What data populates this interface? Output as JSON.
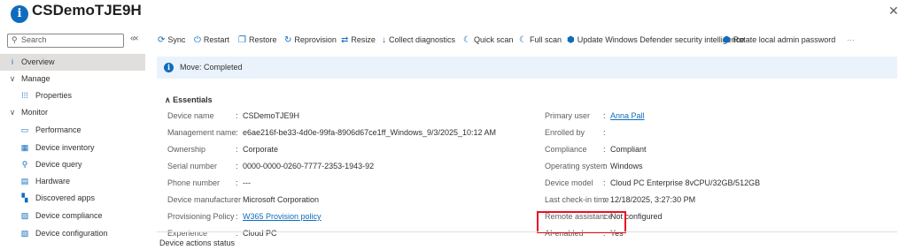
{
  "header": {
    "title": "CSDemoTJE9H",
    "more": "···",
    "close": "✕"
  },
  "sidebar": {
    "search_placeholder": "Search",
    "items": [
      {
        "label": "Overview",
        "icon": "info-icon",
        "glyph": "i",
        "active": true
      },
      {
        "label": "Manage",
        "icon": "chevron-down-icon",
        "glyph": "∨"
      },
      {
        "label": "Properties",
        "icon": "properties-icon",
        "glyph": "⁞⁞⁞"
      },
      {
        "label": "Monitor",
        "icon": "chevron-down-icon",
        "glyph": "∨"
      },
      {
        "label": "Performance",
        "icon": "performance-icon",
        "glyph": "▭"
      },
      {
        "label": "Device inventory",
        "icon": "inventory-icon",
        "glyph": "▦"
      },
      {
        "label": "Device query",
        "icon": "query-icon",
        "glyph": "⚲"
      },
      {
        "label": "Hardware",
        "icon": "hardware-icon",
        "glyph": "▤"
      },
      {
        "label": "Discovered apps",
        "icon": "apps-icon",
        "glyph": "▚"
      },
      {
        "label": "Device compliance",
        "icon": "compliance-icon",
        "glyph": "▨"
      },
      {
        "label": "Device configuration",
        "icon": "configuration-icon",
        "glyph": "▧"
      }
    ]
  },
  "toolbar": [
    {
      "label": "Sync",
      "icon": "sync-icon",
      "glyph": "⟳"
    },
    {
      "label": "Restart",
      "icon": "restart-icon",
      "glyph": "⏻"
    },
    {
      "label": "Restore",
      "icon": "restore-icon",
      "glyph": "❐"
    },
    {
      "label": "Reprovision",
      "icon": "reprovision-icon",
      "glyph": "↻"
    },
    {
      "label": "Resize",
      "icon": "resize-icon",
      "glyph": "⇄"
    },
    {
      "label": "Collect diagnostics",
      "icon": "download-icon",
      "glyph": "↓"
    },
    {
      "label": "Quick scan",
      "icon": "defender-icon",
      "glyph": "☾"
    },
    {
      "label": "Full scan",
      "icon": "defender-icon",
      "glyph": "☾"
    },
    {
      "label": "Update Windows Defender security intelligence",
      "icon": "defender-update-icon",
      "glyph": "⬢"
    },
    {
      "label": "Rotate local admin password",
      "icon": "rotate-password-icon",
      "glyph": "⬢"
    },
    {
      "label": "···",
      "icon": "more-icon",
      "glyph": ""
    }
  ],
  "banner": {
    "text": "Move: Completed"
  },
  "essentials": {
    "heading": "Essentials",
    "left": [
      {
        "label": "Device name",
        "value": "CSDemoTJE9H"
      },
      {
        "label": "Management name",
        "value": "e6ae216f-be33-4d0e-99fa-8906d67ce1ff_Windows_9/3/2025_10:12 AM"
      },
      {
        "label": "Ownership",
        "value": "Corporate"
      },
      {
        "label": "Serial number",
        "value": "0000-0000-0260-7777-2353-1943-92"
      },
      {
        "label": "Phone number",
        "value": "---"
      },
      {
        "label": "Device manufacturer",
        "value": "Microsoft Corporation"
      },
      {
        "label": "Provisioning Policy",
        "value": "W365 Provision policy",
        "link": true
      },
      {
        "label": "Experience",
        "value": "Cloud PC"
      }
    ],
    "right": [
      {
        "label": "Primary user",
        "value": "Anna Pall",
        "link": true
      },
      {
        "label": "Enrolled by",
        "value": ""
      },
      {
        "label": "Compliance",
        "value": "Compliant"
      },
      {
        "label": "Operating system",
        "value": "Windows"
      },
      {
        "label": "Device model",
        "value": "Cloud PC Enterprise 8vCPU/32GB/512GB"
      },
      {
        "label": "Last check-in time",
        "value": "12/18/2025, 3:27:30 PM"
      },
      {
        "label": "Remote assistance",
        "value": "Not configured"
      },
      {
        "label": "AI-enabled",
        "value": "Yes"
      }
    ]
  },
  "section": {
    "device_actions_status": "Device actions status"
  }
}
